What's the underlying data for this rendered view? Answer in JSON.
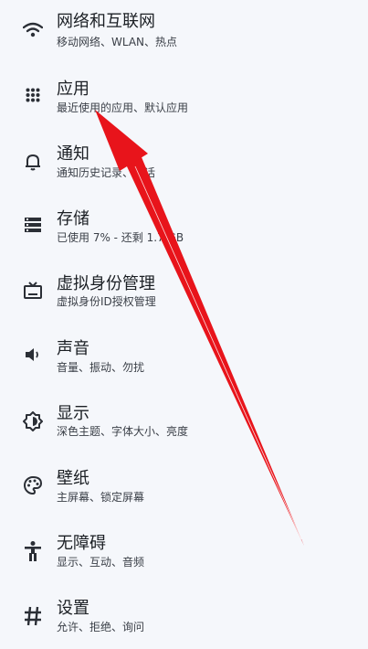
{
  "settings": {
    "items": [
      {
        "title": "网络和互联网",
        "subtitle": "移动网络、WLAN、热点",
        "icon": "wifi-icon"
      },
      {
        "title": "应用",
        "subtitle": "最近使用的应用、默认应用",
        "icon": "apps-grid-icon"
      },
      {
        "title": "通知",
        "subtitle": "通知历史记录、对话",
        "icon": "bell-icon"
      },
      {
        "title": "存储",
        "subtitle": "已使用 7% - 还剩 1.7 GB",
        "icon": "storage-icon"
      },
      {
        "title": "虚拟身份管理",
        "subtitle": "虚拟身份ID授权管理",
        "icon": "tv-icon"
      },
      {
        "title": "声音",
        "subtitle": "音量、振动、勿扰",
        "icon": "volume-icon"
      },
      {
        "title": "显示",
        "subtitle": "深色主题、字体大小、亮度",
        "icon": "brightness-icon"
      },
      {
        "title": "壁纸",
        "subtitle": "主屏幕、锁定屏幕",
        "icon": "palette-icon"
      },
      {
        "title": "无障碍",
        "subtitle": "显示、互动、音频",
        "icon": "accessibility-icon"
      },
      {
        "title": "设置",
        "subtitle": "允许、拒绝、询问",
        "icon": "hash-icon"
      }
    ]
  },
  "colors": {
    "background": "#f5f7fb",
    "arrow": "#e8141b"
  }
}
